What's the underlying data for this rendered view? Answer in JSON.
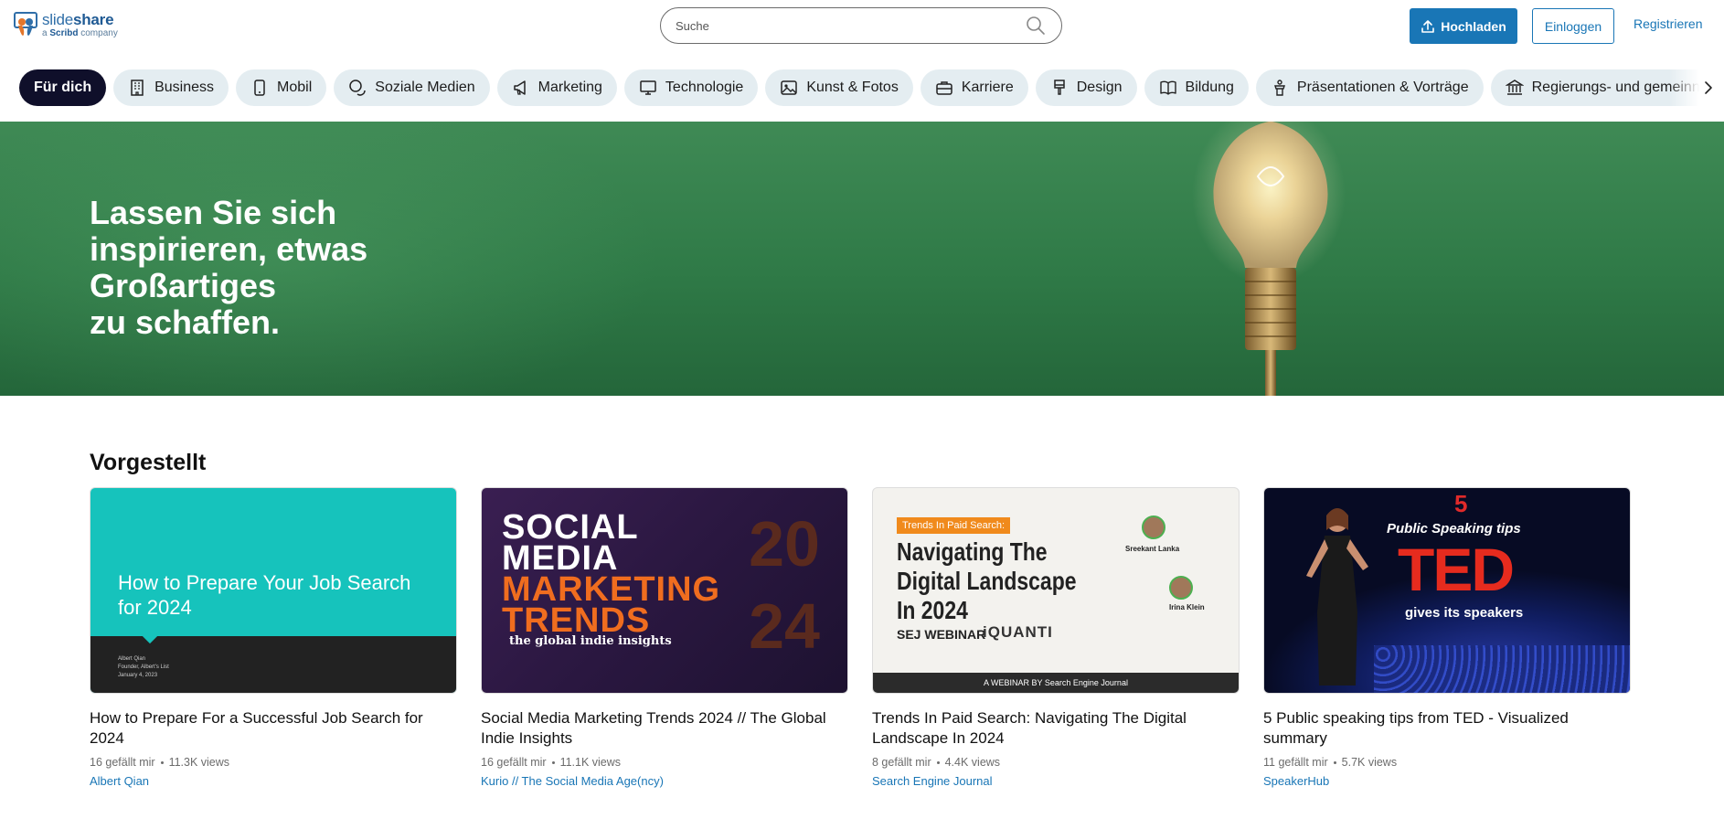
{
  "brand": {
    "name_light": "slide",
    "name_bold": "share",
    "sub_prefix": "a ",
    "sub_bold": "Scribd",
    "sub_suffix": " company"
  },
  "search": {
    "placeholder": "Suche",
    "value": ""
  },
  "header": {
    "upload_label": "Hochladen",
    "login_label": "Einloggen",
    "register_label": "Registrieren"
  },
  "categories": [
    {
      "label": "Für dich",
      "icon": "none",
      "active": true
    },
    {
      "label": "Business",
      "icon": "building-icon"
    },
    {
      "label": "Mobil",
      "icon": "smartphone-icon"
    },
    {
      "label": "Soziale Medien",
      "icon": "chat-bubbles-icon"
    },
    {
      "label": "Marketing",
      "icon": "megaphone-icon"
    },
    {
      "label": "Technologie",
      "icon": "monitor-icon"
    },
    {
      "label": "Kunst & Fotos",
      "icon": "image-icon"
    },
    {
      "label": "Karriere",
      "icon": "briefcase-icon"
    },
    {
      "label": "Design",
      "icon": "paintbrush-icon"
    },
    {
      "label": "Bildung",
      "icon": "open-book-icon"
    },
    {
      "label": "Präsentationen & Vorträge",
      "icon": "podium-icon"
    },
    {
      "label": "Regierungs- und gemeinnützige",
      "icon": "government-building-icon"
    }
  ],
  "hero": {
    "line1": "Lassen Sie sich",
    "line2": "inspirieren, etwas",
    "line3": "Großartiges",
    "line4": "zu schaffen."
  },
  "featured": {
    "title": "Vorgestellt",
    "cards": [
      {
        "title": "How to Prepare For a Successful Job Search for 2024",
        "likes": "16 gefällt mir",
        "views": "11.3K views",
        "author": "Albert Qian",
        "thumb": {
          "headline": "How to Prepare Your Job Search for 2024",
          "small1": "Albert Qian",
          "small2": "Founder, Albert's List",
          "small3": "January 4, 2023"
        }
      },
      {
        "title": "Social Media Marketing Trends 2024 // The Global Indie Insights",
        "likes": "16 gefällt mir",
        "views": "11.1K views",
        "author": "Kurio // The Social Media Age(ncy)",
        "thumb": {
          "line1": "SOCIAL",
          "line2": "MEDIA",
          "line3": "MARKETING",
          "line4": "TRENDS",
          "line5": "the global indie insights",
          "year1": "20",
          "year2": "24"
        }
      },
      {
        "title": "Trends In Paid Search: Navigating The Digital Landscape In 2024",
        "likes": "8 gefällt mir",
        "views": "4.4K views",
        "author": "Search Engine Journal",
        "thumb": {
          "tag": "Trends In Paid Search:",
          "headline": "Navigating The Digital Landscape In 2024",
          "speaker1": "Sreekant Lanka",
          "speaker2": "Irina Klein",
          "logo1": "SEJ WEBINAR",
          "logo2": "iQUANTI",
          "footer": "A WEBINAR BY Search Engine Journal"
        }
      },
      {
        "title": "5 Public speaking tips from TED - Visualized summary",
        "likes": "11 gefällt mir",
        "views": "5.7K views",
        "author": "SpeakerHub",
        "thumb": {
          "num": "5",
          "line1": "Public Speaking tips",
          "line2": "TED",
          "line3": "gives its speakers"
        }
      }
    ]
  },
  "colors": {
    "accent": "#1976b6",
    "chip_bg": "#e4edf1",
    "chip_active_bg": "#0f0f2a",
    "hero_green": "#2f7a47"
  }
}
